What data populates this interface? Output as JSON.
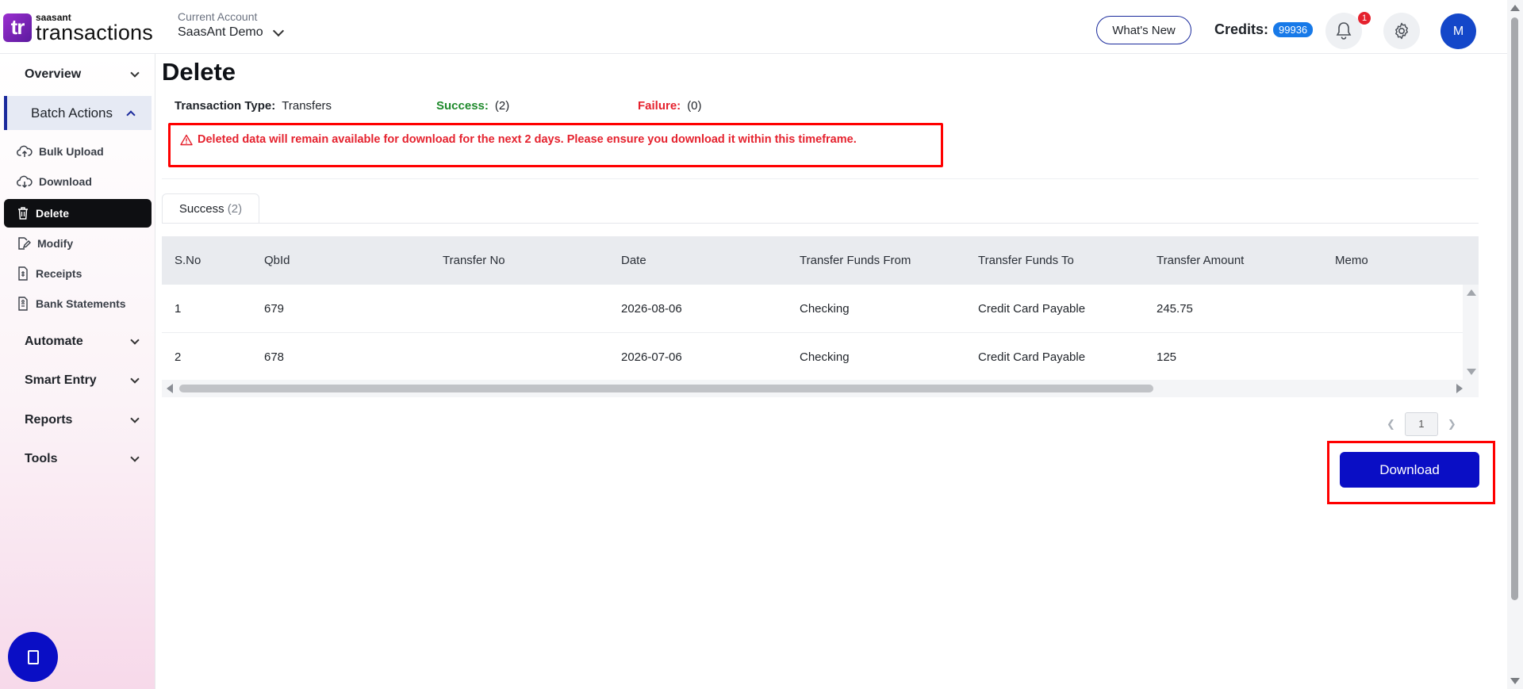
{
  "brand": {
    "logo_mark": "tr",
    "logo_top": "saasant",
    "logo_bottom": "transactions"
  },
  "account": {
    "caption": "Current Account",
    "name": "SaasAnt Demo"
  },
  "header": {
    "whats_new": "What's New",
    "credits_label": "Credits:",
    "credits_value": "99936",
    "notification_count": "1",
    "avatar_initial": "M"
  },
  "sidebar": {
    "groups": [
      {
        "label": "Overview"
      },
      {
        "label": "Batch Actions"
      },
      {
        "label": "Automate"
      },
      {
        "label": "Smart Entry"
      },
      {
        "label": "Reports"
      },
      {
        "label": "Tools"
      }
    ],
    "batch_items": [
      {
        "label": "Bulk Upload",
        "icon": "upload-cloud-icon"
      },
      {
        "label": "Download",
        "icon": "download-cloud-icon"
      },
      {
        "label": "Delete",
        "icon": "trash-icon"
      },
      {
        "label": "Modify",
        "icon": "edit-file-icon"
      },
      {
        "label": "Receipts",
        "icon": "receipt-icon"
      },
      {
        "label": "Bank Statements",
        "icon": "bank-statement-icon"
      }
    ]
  },
  "main": {
    "title": "Delete",
    "transaction_type_label": "Transaction Type:",
    "transaction_type_value": "Transfers",
    "success_label": "Success:",
    "success_value": "(2)",
    "failure_label": "Failure:",
    "failure_value": "(0)",
    "warning": "Deleted data will remain available for download for the next 2 days. Please ensure you download it within this timeframe.",
    "tab_label": "Success",
    "tab_count": "(2)",
    "table": {
      "headers": [
        "S.No",
        "QbId",
        "Transfer No",
        "Date",
        "Transfer Funds From",
        "Transfer Funds To",
        "Transfer Amount",
        "Memo"
      ],
      "rows": [
        [
          "1",
          "679",
          "",
          "2026-08-06",
          "Checking",
          "Credit Card Payable",
          "245.75",
          ""
        ],
        [
          "2",
          "678",
          "",
          "2026-07-06",
          "Checking",
          "Credit Card Payable",
          "125",
          ""
        ]
      ]
    },
    "pager": {
      "current_page": "1"
    },
    "download_button": "Download"
  },
  "colors": {
    "accent": "#0a0ec5",
    "success": "#1f8a2c",
    "failure": "#e5222e",
    "credits_badge": "#1779e8"
  }
}
